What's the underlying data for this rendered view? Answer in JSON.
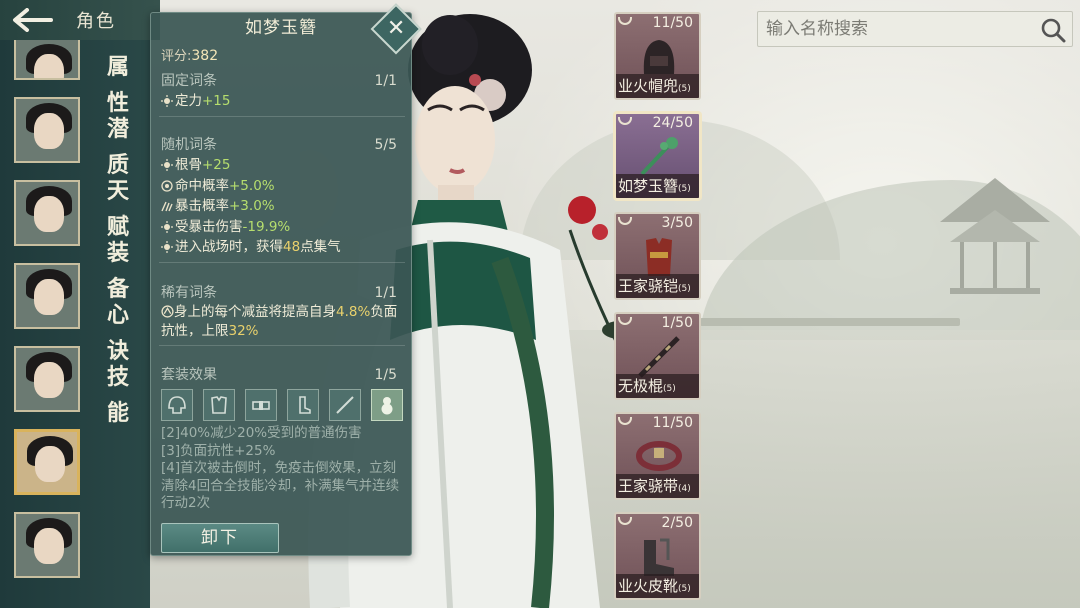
{
  "header": {
    "title": "角色"
  },
  "sidebar": {
    "tabs": [
      {
        "label": "属性"
      },
      {
        "label": "潜质"
      },
      {
        "label": "天赋"
      },
      {
        "label": "装备"
      },
      {
        "label": "心诀"
      },
      {
        "label": "技能"
      }
    ]
  },
  "item": {
    "name": "如梦玉簪",
    "score_label": "评分:",
    "score": "382",
    "fixed": {
      "title": "固定词条",
      "count": "1/1",
      "lines": [
        {
          "text": "定力",
          "value": "+15"
        }
      ]
    },
    "random": {
      "title": "随机词条",
      "count": "5/5",
      "lines": [
        {
          "text": "根骨",
          "value": "+25"
        },
        {
          "text": "命中概率",
          "value": "+5.0%"
        },
        {
          "text": "暴击概率",
          "value": "+3.0%"
        },
        {
          "text": "受暴击伤害",
          "value": "-19.9%"
        }
      ],
      "extra_pre": "进入战场时，获得",
      "extra_num": "48",
      "extra_post": "点集气"
    },
    "rare": {
      "title": "稀有词条",
      "count": "1/1",
      "text_pre": "身上的每个减益将提高自身",
      "num1": "4.8%",
      "text_mid": "负面抗性，上限",
      "num2": "32%"
    },
    "set": {
      "title": "套装效果",
      "count": "1/5",
      "icons": [
        "helmet-icon",
        "armor-icon",
        "belt-icon",
        "boot-icon",
        "staff-icon",
        "gourd-icon"
      ],
      "effects": [
        "[2]40%减少20%受到的普通伤害",
        "[3]负面抗性+25%",
        "[4]首次被击倒时，免疫击倒效果，立刻清除4回合全技能冷却，补满集气并连续行动2次"
      ]
    },
    "unequip_label": "卸下"
  },
  "equipment": [
    {
      "durability": "11/50",
      "name": "业火帽兜",
      "level": "(5)",
      "icon": "hood-icon"
    },
    {
      "durability": "24/50",
      "name": "如梦玉簪",
      "level": "(5)",
      "icon": "hairpin-icon"
    },
    {
      "durability": "3/50",
      "name": "王家骁铠",
      "level": "(5)",
      "icon": "armor-icon"
    },
    {
      "durability": "1/50",
      "name": "无极棍",
      "level": "(5)",
      "icon": "staff-icon"
    },
    {
      "durability": "11/50",
      "name": "王家骁带",
      "level": "(4)",
      "icon": "belt-icon"
    },
    {
      "durability": "2/50",
      "name": "业火皮靴",
      "level": "(5)",
      "icon": "boot-icon"
    }
  ],
  "search": {
    "placeholder": "输入名称搜索"
  },
  "colors": {
    "panel": "#3a5654",
    "accent_green": "#b6de6e",
    "accent_yellow": "#e9d16c",
    "slot_red": "#7d5f64",
    "slot_purple": "#775f80"
  }
}
